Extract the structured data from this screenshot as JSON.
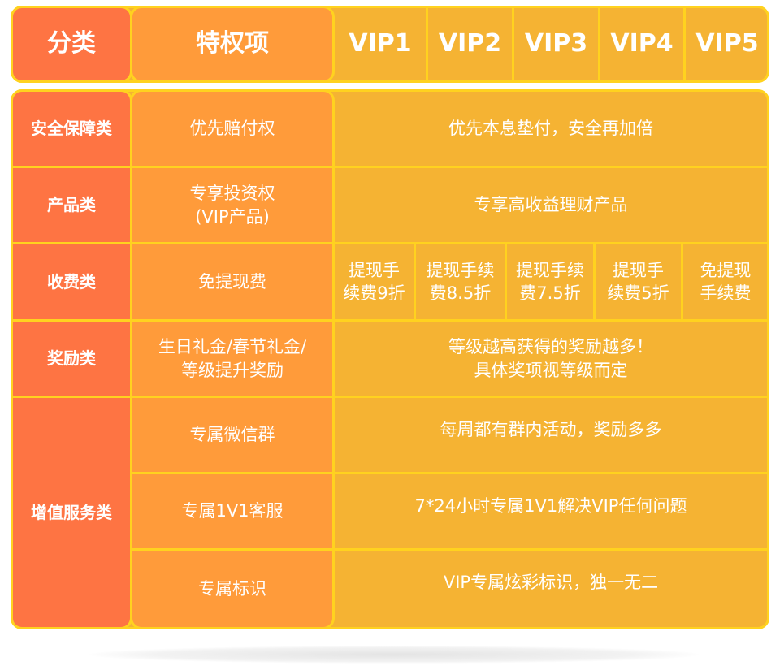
{
  "header": {
    "category": "分类",
    "privilege": "特权项",
    "levels": [
      "VIP1",
      "VIP2",
      "VIP3",
      "VIP4",
      "VIP5"
    ]
  },
  "rows": {
    "security": {
      "category": "安全保障类",
      "privilege": "优先赔付权",
      "benefit": "优先本息垫付，安全再加倍"
    },
    "product": {
      "category": "产品类",
      "privilege_line1": "专享投资权",
      "privilege_line2": "(VIP产品)",
      "benefit": "专享高收益理财产品"
    },
    "fee": {
      "category": "收费类",
      "privilege": "免提现费",
      "levels": [
        {
          "line1": "提现手",
          "line2": "续费9折"
        },
        {
          "line1": "提现手续",
          "line2": "费8.5折"
        },
        {
          "line1": "提现手续",
          "line2": "费7.5折"
        },
        {
          "line1": "提现手",
          "line2": "续费5折"
        },
        {
          "line1": "免提现",
          "line2": "手续费"
        }
      ]
    },
    "reward": {
      "category": "奖励类",
      "privilege_line1": "生日礼金/春节礼金/",
      "privilege_line2": "等级提升奖励",
      "benefit_line1": "等级越高获得的奖励越多！",
      "benefit_line2": "具体奖项视等级而定"
    },
    "value_added": {
      "category": "增值服务类",
      "items": [
        {
          "privilege": "专属微信群",
          "benefit": "每周都有群内活动，奖励多多"
        },
        {
          "privilege": "专属1V1客服",
          "benefit": "7*24小时专属1V1解决VIP任何问题"
        },
        {
          "privilege": "专属标识",
          "benefit": "VIP专属炫彩标识，独一无二"
        }
      ]
    }
  },
  "colors": {
    "category": "#FE7443",
    "privilege": "#FF9B3A",
    "levels": "#F5B333",
    "border": "#FFD21F"
  }
}
